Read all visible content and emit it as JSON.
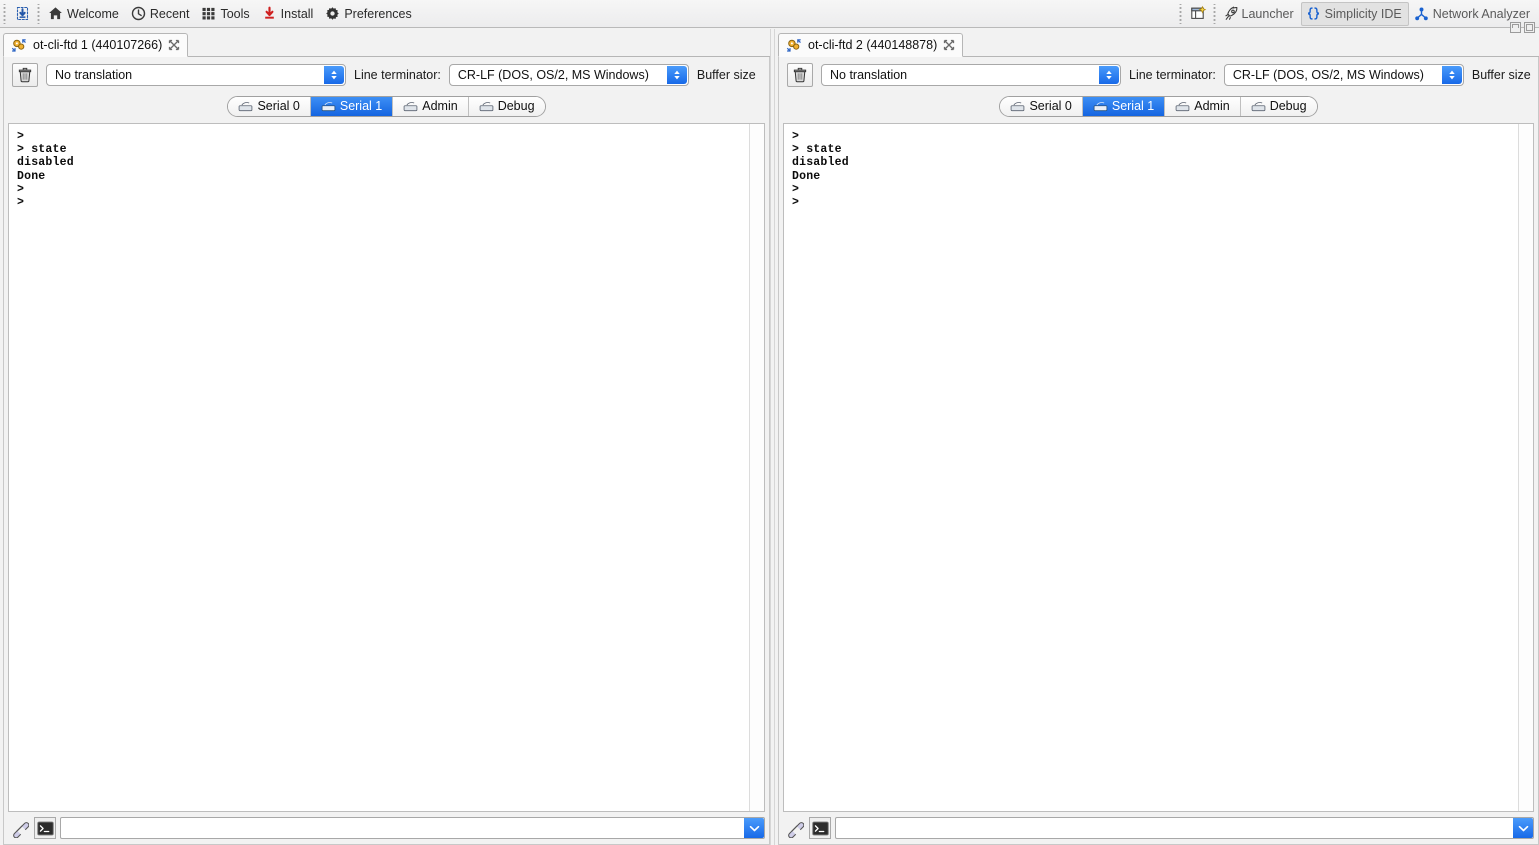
{
  "toolbar": {
    "left_items": [
      {
        "label": "Welcome",
        "icon": "home-icon"
      },
      {
        "label": "Recent",
        "icon": "clock-icon"
      },
      {
        "label": "Tools",
        "icon": "grid-icon"
      },
      {
        "label": "Install",
        "icon": "download-icon"
      },
      {
        "label": "Preferences",
        "icon": "gear-icon"
      }
    ],
    "flash_icon": "chip-flash-icon",
    "new_perspective_icon": "new-perspective-icon",
    "perspectives": [
      {
        "label": "Launcher",
        "icon": "launcher-icon",
        "active": false
      },
      {
        "label": "Simplicity IDE",
        "icon": "braces-icon",
        "active": true
      },
      {
        "label": "Network Analyzer",
        "icon": "network-analyzer-icon",
        "active": false
      }
    ]
  },
  "window_controls": {
    "minimize": "minimize-button",
    "maximize": "maximize-button"
  },
  "panes": [
    {
      "tab_title": "ot-cli-ftd 1 (440107266)",
      "tab_icon": "serial-console-icon",
      "close_icon": "close-icon",
      "translation": {
        "value": "No translation"
      },
      "terminator": {
        "label": "Line terminator:",
        "value": "CR-LF  (DOS, OS/2, MS Windows)"
      },
      "buffer_label": "Buffer size",
      "clear_icon": "trash-icon",
      "serial_tabs": [
        {
          "label": "Serial 0",
          "selected": false
        },
        {
          "label": "Serial 1",
          "selected": true
        },
        {
          "label": "Admin",
          "selected": false
        },
        {
          "label": "Debug",
          "selected": false
        }
      ],
      "terminal_lines": [
        ">",
        "> state",
        "disabled",
        "Done",
        ">",
        ">"
      ],
      "input": {
        "value": "",
        "placeholder": ""
      },
      "input_icons": [
        "connection-icon",
        "console-icon"
      ],
      "input_dropdown_icon": "chevron-down-icon"
    },
    {
      "tab_title": "ot-cli-ftd 2 (440148878)",
      "tab_icon": "serial-console-icon",
      "close_icon": "close-icon",
      "translation": {
        "value": "No translation"
      },
      "terminator": {
        "label": "Line terminator:",
        "value": "CR-LF  (DOS, OS/2, MS Windows)"
      },
      "buffer_label": "Buffer size",
      "clear_icon": "trash-icon",
      "serial_tabs": [
        {
          "label": "Serial 0",
          "selected": false
        },
        {
          "label": "Serial 1",
          "selected": true
        },
        {
          "label": "Admin",
          "selected": false
        },
        {
          "label": "Debug",
          "selected": false
        }
      ],
      "terminal_lines": [
        ">",
        "> state",
        "disabled",
        "Done",
        ">",
        ">"
      ],
      "input": {
        "value": "",
        "placeholder": ""
      },
      "input_icons": [
        "connection-icon",
        "console-icon"
      ],
      "input_dropdown_icon": "chevron-down-icon"
    }
  ],
  "colors": {
    "accent_blue": "#1769e8",
    "toolbar_bg": "#ececed",
    "terminal_bg": "#ffffff",
    "terminal_fg": "#0b0b0b"
  }
}
